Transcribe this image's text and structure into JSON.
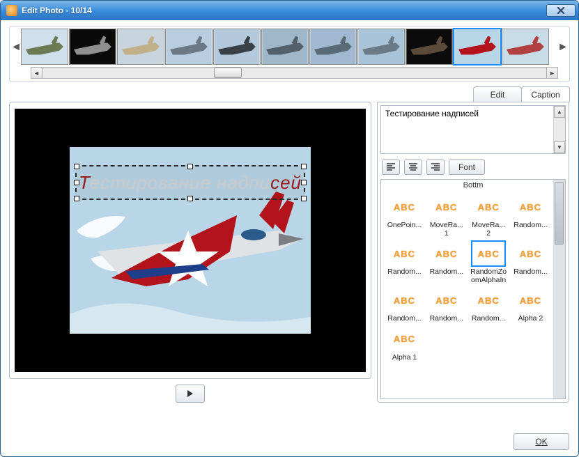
{
  "window": {
    "title": "Edit Photo - 10/14"
  },
  "tabs": {
    "edit": "Edit",
    "caption": "Caption",
    "active": "caption"
  },
  "caption": {
    "text": "Тестирование надписей"
  },
  "overlay": {
    "prefix": "Т",
    "mid": "естирование надпи",
    "suffix": "сей"
  },
  "toolbar": {
    "font": "Font"
  },
  "effects": {
    "header": "Bottm",
    "items": [
      {
        "label": "OnePoin...",
        "selected": false
      },
      {
        "label": "MoveRa... 1",
        "selected": false
      },
      {
        "label": "MoveRa... 2",
        "selected": false
      },
      {
        "label": "Random...",
        "selected": false
      },
      {
        "label": "Random...",
        "selected": false
      },
      {
        "label": "Random...",
        "selected": false
      },
      {
        "label": "RandomZoomAlphaIn",
        "selected": true
      },
      {
        "label": "Random...",
        "selected": false
      },
      {
        "label": "Random...",
        "selected": false
      },
      {
        "label": "Random...",
        "selected": false
      },
      {
        "label": "Random...",
        "selected": false
      },
      {
        "label": "Alpha 2",
        "selected": false
      },
      {
        "label": "Alpha 1",
        "selected": false
      }
    ]
  },
  "footer": {
    "ok": "OK"
  },
  "thumbs": {
    "count": 11,
    "selected_index": 9
  }
}
